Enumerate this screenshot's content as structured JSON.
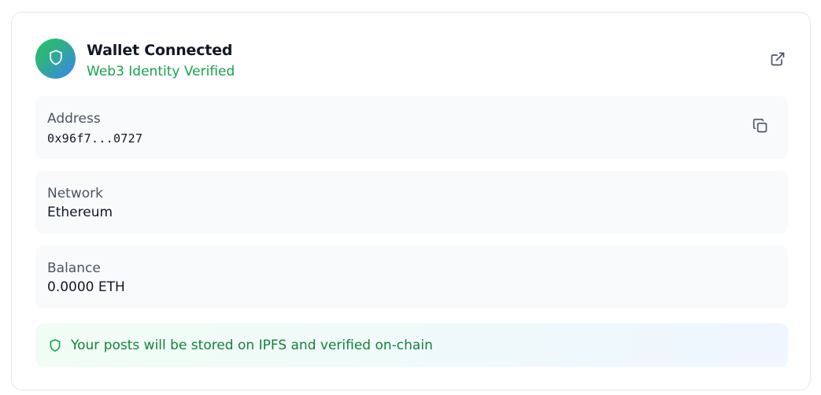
{
  "header": {
    "title": "Wallet Connected",
    "subtitle": "Web3 Identity Verified",
    "avatar_icon": "shield-icon",
    "external_icon": "external-link-icon"
  },
  "fields": {
    "address": {
      "label": "Address",
      "value": "0x96f7...0727",
      "action_icon": "copy-icon"
    },
    "network": {
      "label": "Network",
      "value": "Ethereum"
    },
    "balance": {
      "label": "Balance",
      "value": "0.0000 ETH"
    }
  },
  "notice": {
    "text": "Your posts will be stored on IPFS and verified on-chain",
    "icon": "shield-icon"
  },
  "colors": {
    "accent_green": "#16a34a",
    "accent_blue": "#3b82f6",
    "box_bg": "#f9fafb"
  }
}
